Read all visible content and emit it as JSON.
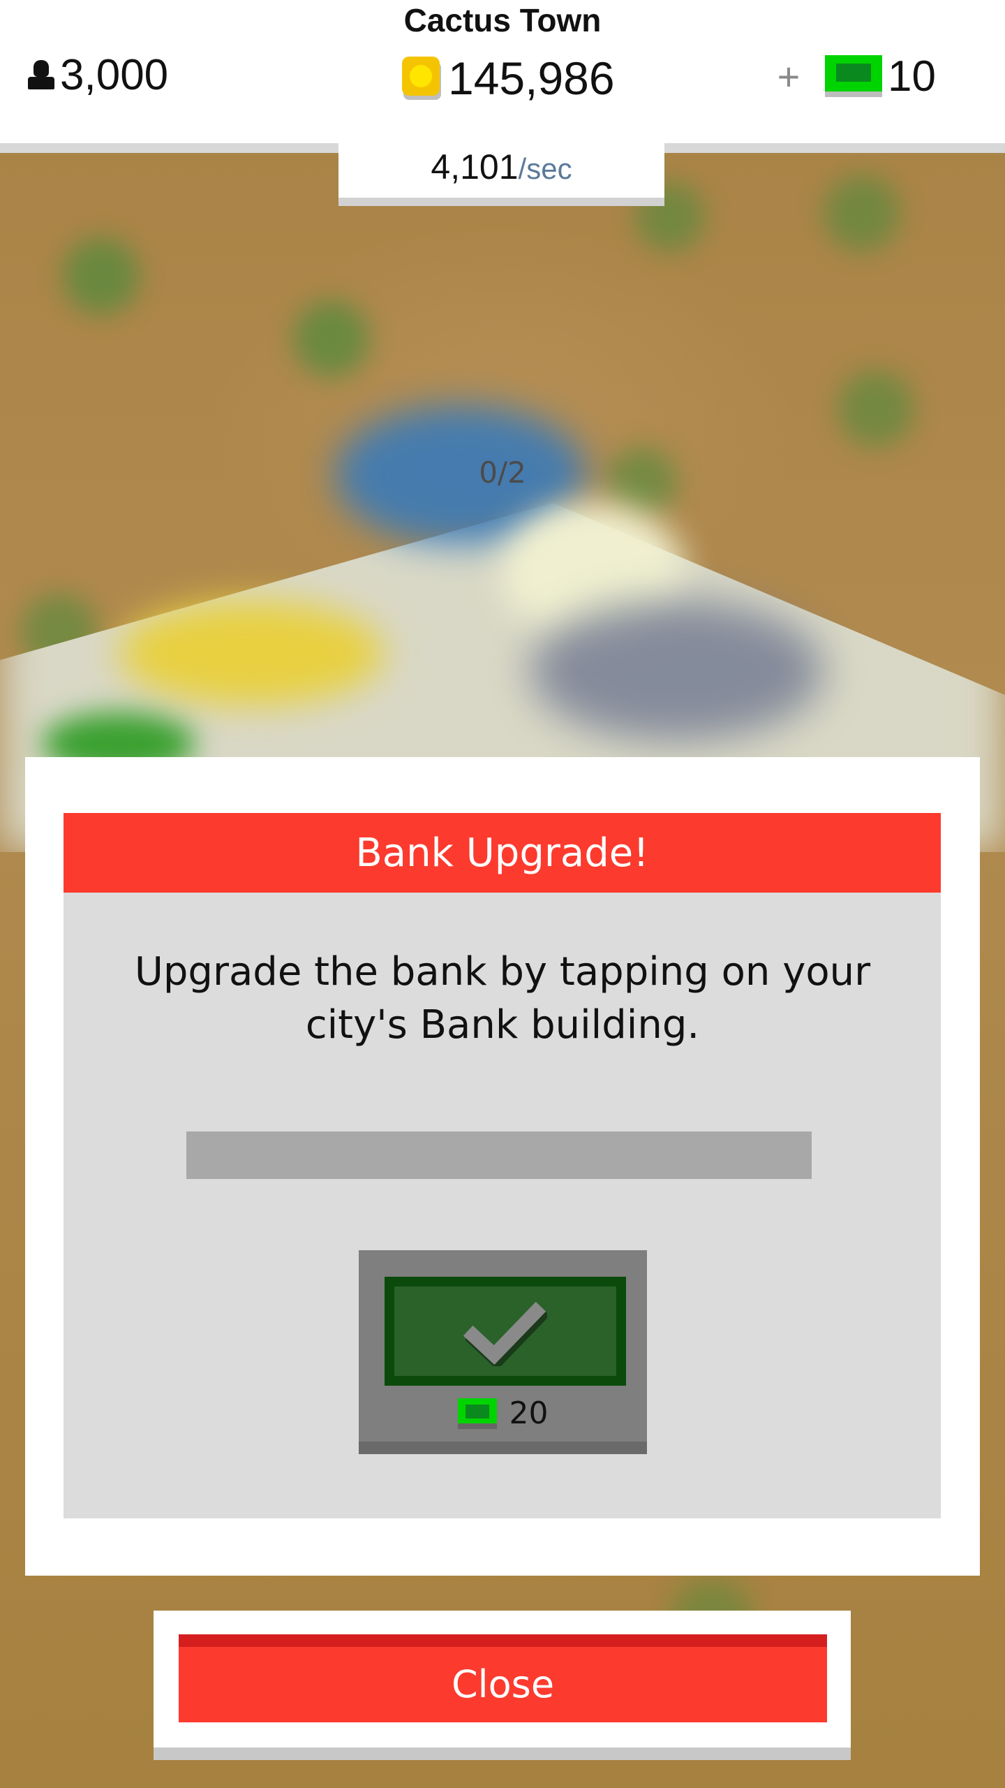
{
  "hud": {
    "town_name": "Cactus Town",
    "population": "3,000",
    "coins": "145,986",
    "plus_label": "+",
    "cash": "10",
    "rate_value": "4,101",
    "rate_unit": "/sec"
  },
  "dialog": {
    "title": "Bank Upgrade!",
    "message": "Upgrade the bank by tapping on your city's Bank building.",
    "progress_text": "0/2",
    "progress_fraction": 0,
    "complete_cost": "20"
  },
  "close_button": {
    "label": "Close"
  },
  "colors": {
    "header_red": "#fd3a2e",
    "cash_green": "#00d400",
    "button_dark_green": "#0b4a0b",
    "coin_yellow": "#f5c400"
  }
}
